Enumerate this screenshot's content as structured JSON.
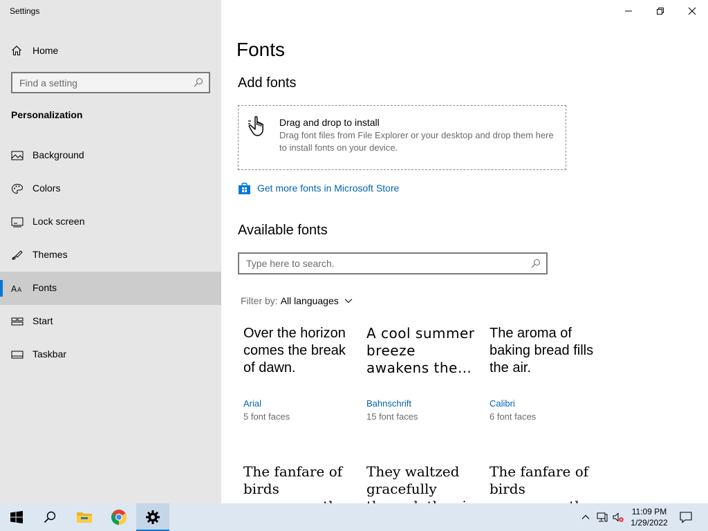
{
  "window": {
    "title": "Settings"
  },
  "sidebar": {
    "home_label": "Home",
    "search_placeholder": "Find a setting",
    "section_label": "Personalization",
    "items": [
      {
        "label": "Background",
        "icon": "background-icon"
      },
      {
        "label": "Colors",
        "icon": "palette-icon"
      },
      {
        "label": "Lock screen",
        "icon": "lock-screen-icon"
      },
      {
        "label": "Themes",
        "icon": "themes-icon"
      },
      {
        "label": "Fonts",
        "icon": "fonts-icon",
        "selected": true
      },
      {
        "label": "Start",
        "icon": "start-icon"
      },
      {
        "label": "Taskbar",
        "icon": "taskbar-icon"
      }
    ]
  },
  "main": {
    "title": "Fonts",
    "add_fonts_heading": "Add fonts",
    "dropzone": {
      "title": "Drag and drop to install",
      "description": "Drag font files from File Explorer or your desktop and drop them here to install fonts on your device."
    },
    "store_link": "Get more fonts in Microsoft Store",
    "available_heading": "Available fonts",
    "search_placeholder": "Type here to search.",
    "filter": {
      "label": "Filter by:",
      "value": "All languages"
    },
    "fonts": [
      {
        "sample": "Over the horizon comes the break of dawn.",
        "name": "Arial",
        "faces": "5 font faces"
      },
      {
        "sample": "A cool summer breeze awakens the…",
        "name": "Bahnschrift",
        "faces": "15 font faces"
      },
      {
        "sample": "The aroma of baking bread fills the air.",
        "name": "Calibri",
        "faces": "6 font faces"
      },
      {
        "sample": "The fanfare of birds announces the morning.",
        "name": "",
        "faces": ""
      },
      {
        "sample": "They waltzed gracefully through the air.",
        "name": "",
        "faces": ""
      },
      {
        "sample": "The fanfare of birds announces the morning.",
        "name": "",
        "faces": ""
      }
    ]
  },
  "taskbar": {
    "time": "11:09 PM",
    "date": "1/29/2022"
  },
  "colors": {
    "accent": "#0078d7",
    "link": "#0063b1",
    "sidebar_bg": "#e6e6e6",
    "taskbar_bg": "#dce7f2"
  }
}
